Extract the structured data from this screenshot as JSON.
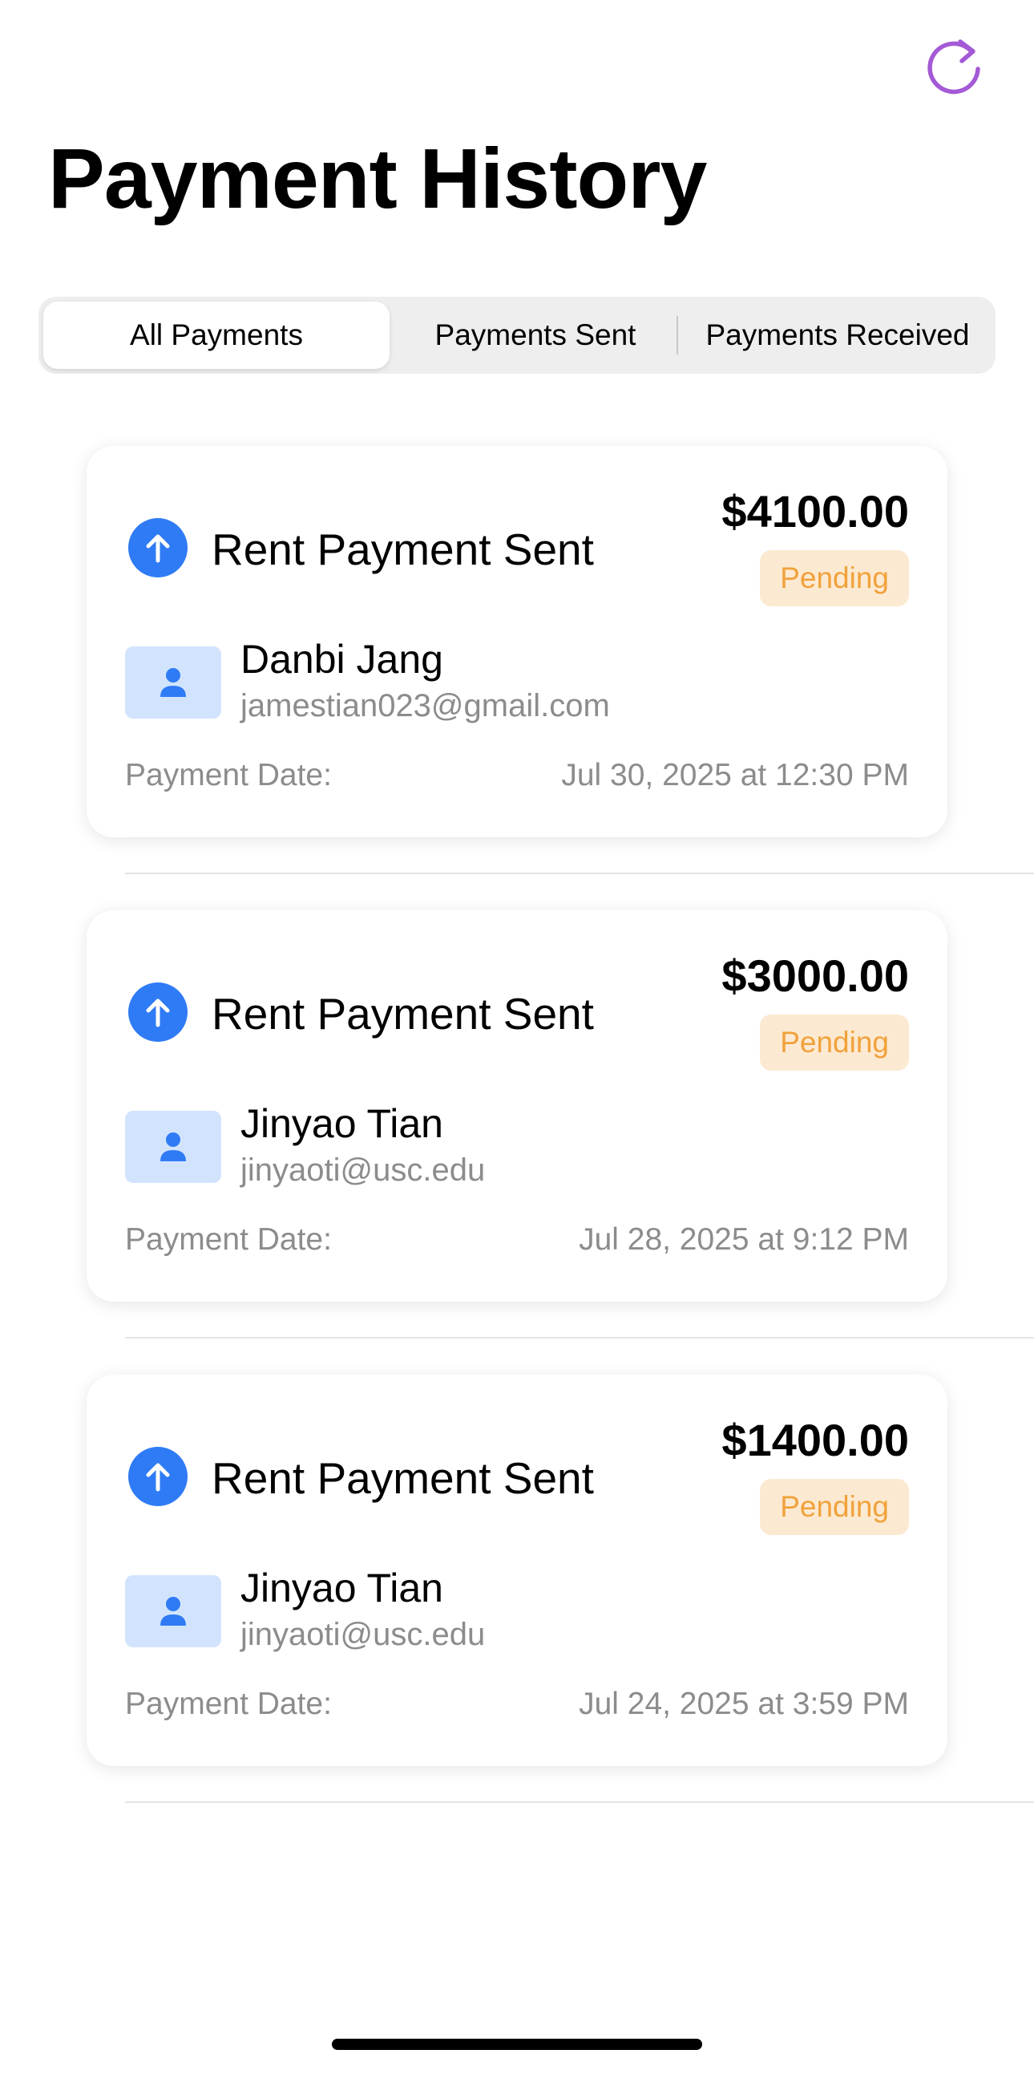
{
  "header": {
    "title": "Payment History",
    "refresh_icon": "arrow-clockwise-icon",
    "refresh_color": "#a45ad6"
  },
  "tabs": [
    {
      "label": "All Payments",
      "selected": true
    },
    {
      "label": "Payments Sent",
      "selected": false
    },
    {
      "label": "Payments Received",
      "selected": false
    }
  ],
  "payments": [
    {
      "title": "Rent Payment Sent",
      "direction_icon": "arrow-up-icon",
      "amount": "$4100.00",
      "status": "Pending",
      "name": "Danbi Jang",
      "email": "jamestian023@gmail.com",
      "date_label": "Payment Date:",
      "date": "Jul 30, 2025 at 12:30 PM"
    },
    {
      "title": "Rent Payment Sent",
      "direction_icon": "arrow-up-icon",
      "amount": "$3000.00",
      "status": "Pending",
      "name": "Jinyao Tian",
      "email": "jinyaoti@usc.edu",
      "date_label": "Payment Date:",
      "date": "Jul 28, 2025 at 9:12 PM"
    },
    {
      "title": "Rent Payment Sent",
      "direction_icon": "arrow-up-icon",
      "amount": "$1400.00",
      "status": "Pending",
      "name": "Jinyao Tian",
      "email": "jinyaoti@usc.edu",
      "date_label": "Payment Date:",
      "date": "Jul 24, 2025 at 3:59 PM"
    }
  ],
  "colors": {
    "accent_blue": "#2f7bf5",
    "pending_text": "#f0a23b",
    "pending_bg": "#fce9d1",
    "avatar_bg": "#d2e4fd"
  }
}
